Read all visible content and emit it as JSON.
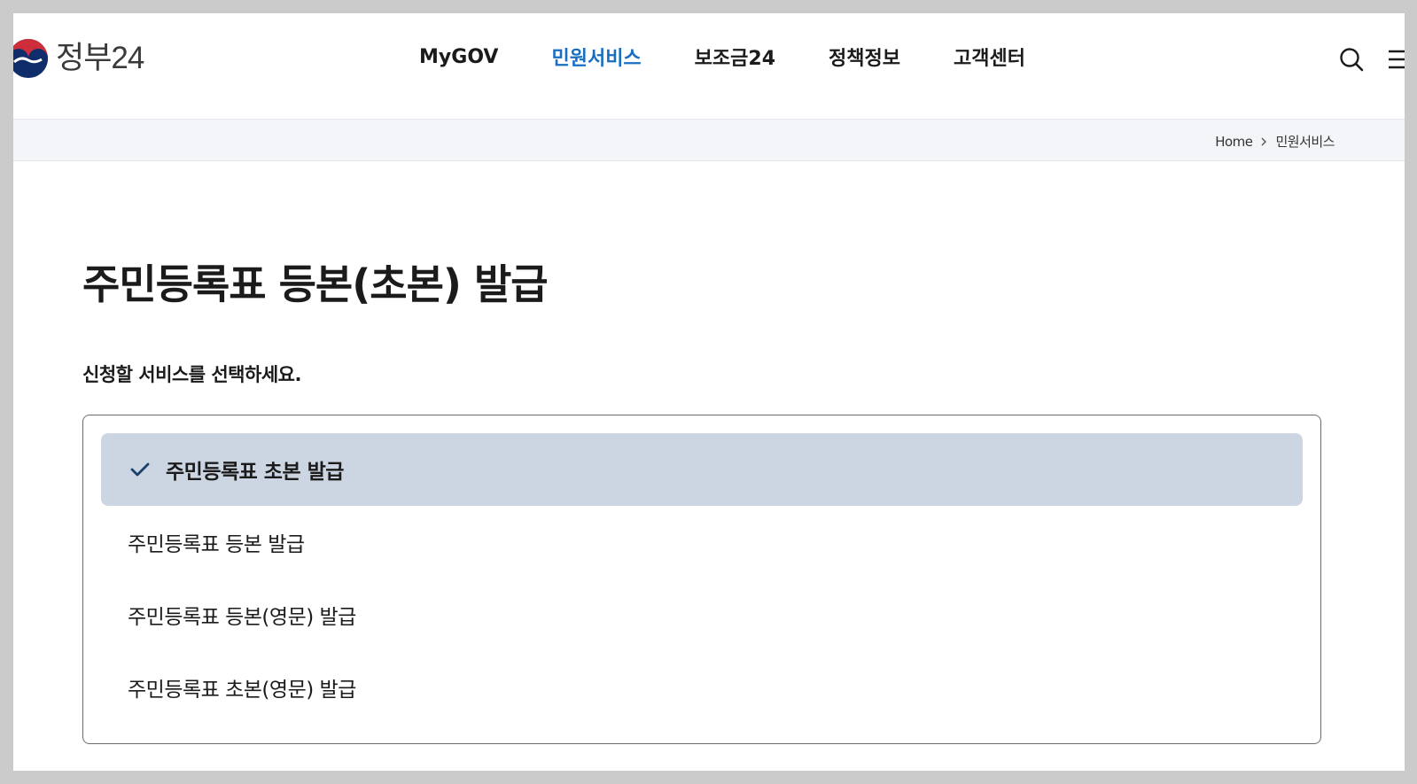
{
  "header": {
    "logo_text": "정부24",
    "nav": [
      {
        "label": "MyGOV",
        "active": false
      },
      {
        "label": "민원서비스",
        "active": true
      },
      {
        "label": "보조금24",
        "active": false
      },
      {
        "label": "정책정보",
        "active": false
      },
      {
        "label": "고객센터",
        "active": false
      }
    ],
    "icons": [
      "search-icon",
      "menu-icon"
    ]
  },
  "breadcrumb": {
    "home": "Home",
    "current": "민원서비스"
  },
  "main": {
    "title": "주민등록표 등본(초본) 발급",
    "instruction": "신청할 서비스를 선택하세요.",
    "options": [
      {
        "label": "주민등록표 초본 발급",
        "selected": true
      },
      {
        "label": "주민등록표 등본 발급",
        "selected": false
      },
      {
        "label": "주민등록표 등본(영문) 발급",
        "selected": false
      },
      {
        "label": "주민등록표 초본(영문) 발급",
        "selected": false
      }
    ]
  },
  "colors": {
    "accent": "#1a6ec2",
    "selected_bg": "#ccd6e2",
    "check": "#1d3f6e",
    "logo_red": "#cd2e3a",
    "logo_blue": "#0f2c6b"
  }
}
